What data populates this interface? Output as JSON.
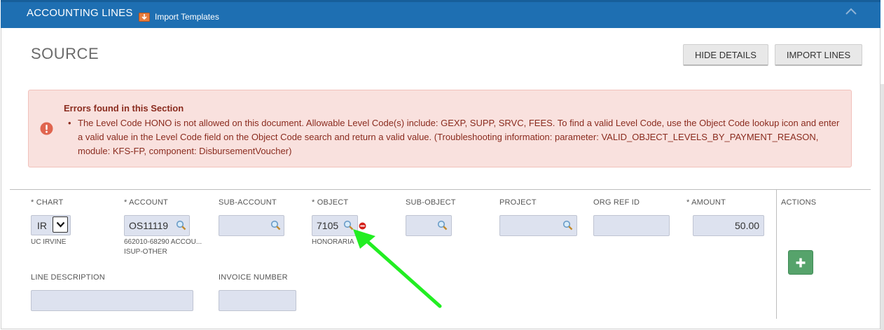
{
  "header": {
    "title": "ACCOUNTING LINES",
    "import_templates": "Import Templates"
  },
  "section": {
    "title": "SOURCE",
    "hide_details": "HIDE DETAILS",
    "import_lines": "IMPORT LINES"
  },
  "error": {
    "heading": "Errors found in this Section",
    "bullet": "•",
    "message": "The Level Code HONO is not allowed on this document. Allowable Level Code(s) include: GEXP, SUPP, SRVC, FEES. To find a valid Level Code, use the Object Code lookup icon and enter a valid value in the Level Code field on the Object Code search and return a valid value. (Troubleshooting information: parameter: VALID_OBJECT_LEVELS_BY_PAYMENT_REASON, module: KFS-FP, component: DisbursementVoucher)"
  },
  "line": {
    "chart": {
      "label": "* CHART",
      "value": "IR",
      "description": "UC IRVINE"
    },
    "account": {
      "label": "* ACCOUNT",
      "value": "OS11119",
      "description_line1": "662010-68290 ACCOU...",
      "description_line2": "ISUP-OTHER"
    },
    "sub_account": {
      "label": "SUB-ACCOUNT",
      "value": ""
    },
    "object": {
      "label": "* OBJECT",
      "value": "7105",
      "description": "HONORARIA"
    },
    "sub_object": {
      "label": "SUB-OBJECT",
      "value": ""
    },
    "project": {
      "label": "PROJECT",
      "value": ""
    },
    "org_ref_id": {
      "label": "ORG REF ID",
      "value": ""
    },
    "amount": {
      "label": "* AMOUNT",
      "value": "50.00"
    },
    "actions": {
      "label": "ACTIONS"
    },
    "line_description": {
      "label": "LINE DESCRIPTION",
      "value": ""
    },
    "invoice_number": {
      "label": "INVOICE NUMBER",
      "value": ""
    }
  },
  "colors": {
    "header_bg": "#1e6fb2",
    "error_bg": "#f9e1de",
    "error_text": "#8a2b1e",
    "field_bg": "#dde2ef",
    "add_button": "#56a36b",
    "annotation_arrow": "#22ee22"
  },
  "icons": {
    "import": "import-templates-icon",
    "collapse": "chevron-up-icon",
    "error": "error-exclamation-icon",
    "lookup": "magnifier-icon",
    "remove": "remove-circle-icon",
    "add": "plus-icon"
  }
}
